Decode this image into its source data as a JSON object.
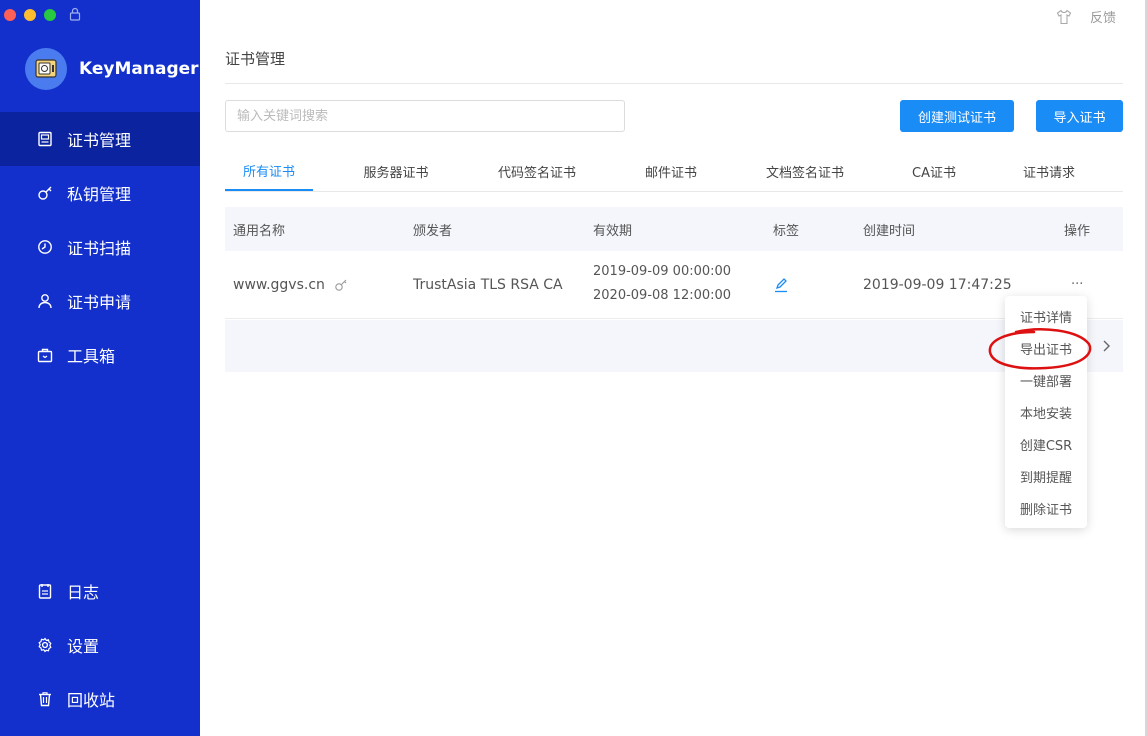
{
  "window": {
    "close_color": "#fe5f57",
    "minimize_color": "#febc2e",
    "maximize_color": "#28c840"
  },
  "app": {
    "name": "KeyManager",
    "sidebar_color": "#1330cc",
    "accent": "#1a8cf5",
    "annotation_color": "#dd1111"
  },
  "sidebar": {
    "items": [
      {
        "label": "证书管理",
        "icon": "certificate-icon",
        "active": true
      },
      {
        "label": "私钥管理",
        "icon": "key-icon"
      },
      {
        "label": "证书扫描",
        "icon": "scan-clock-icon"
      },
      {
        "label": "证书申请",
        "icon": "user-icon"
      },
      {
        "label": "工具箱",
        "icon": "toolbox-icon"
      }
    ],
    "bottom_items": [
      {
        "label": "日志",
        "icon": "log-icon"
      },
      {
        "label": "设置",
        "icon": "gear-icon"
      },
      {
        "label": "回收站",
        "icon": "trash-icon"
      }
    ]
  },
  "header": {
    "feedback_label": "反馈",
    "feedback_icon": "shirt-icon"
  },
  "main": {
    "title": "证书管理",
    "search": {
      "placeholder": "输入关键词搜索",
      "value": ""
    },
    "buttons": {
      "create_test": "创建测试证书",
      "import": "导入证书"
    },
    "tabs": [
      {
        "label": "所有证书",
        "active": true
      },
      {
        "label": "服务器证书"
      },
      {
        "label": "代码签名证书"
      },
      {
        "label": "邮件证书"
      },
      {
        "label": "文档签名证书"
      },
      {
        "label": "CA证书"
      },
      {
        "label": "证书请求"
      }
    ],
    "table": {
      "columns": [
        "通用名称",
        "颁发者",
        "有效期",
        "标签",
        "创建时间",
        "操作"
      ],
      "rows": [
        {
          "common_name": "www.ggvs.cn",
          "issuer": "TrustAsia TLS RSA CA",
          "valid_from": "2019-09-09 00:00:00",
          "valid_to": "2020-09-08 12:00:00",
          "tag_icon": "edit-pencil-icon",
          "created": "2019-09-09 17:47:25",
          "actions": "···"
        }
      ]
    },
    "action_menu": {
      "items": [
        "证书详情",
        "导出证书",
        "一键部署",
        "本地安装",
        "创建CSR",
        "到期提醒",
        "删除证书"
      ],
      "highlighted_item": "导出证书"
    }
  }
}
